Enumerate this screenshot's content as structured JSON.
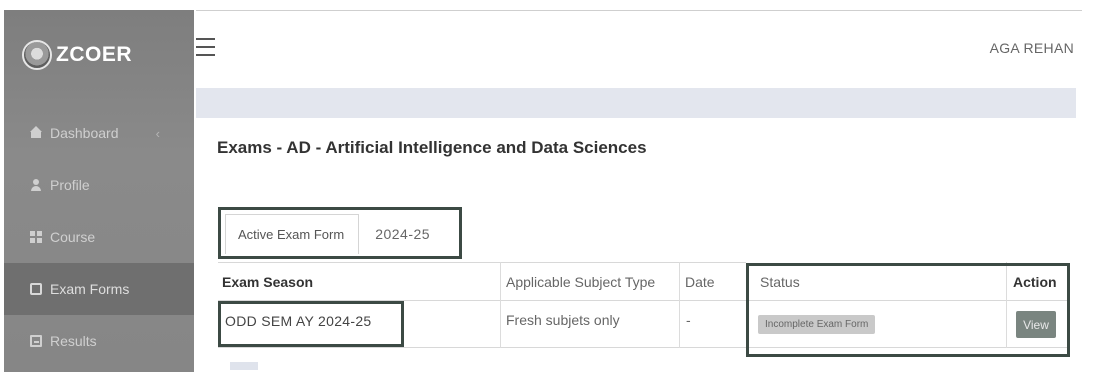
{
  "brand": {
    "name": "ZCOER",
    "logo_icon": "college-emblem-icon"
  },
  "sidebar": {
    "items": [
      {
        "label": "Dashboard",
        "icon": "home-icon",
        "active": false,
        "has_chevron": true
      },
      {
        "label": "Profile",
        "icon": "user-icon",
        "active": false
      },
      {
        "label": "Course",
        "icon": "grid-icon",
        "active": false
      },
      {
        "label": "Exam Forms",
        "icon": "document-icon",
        "active": true
      },
      {
        "label": "Results",
        "icon": "chart-icon",
        "active": false
      }
    ],
    "chevron": "‹"
  },
  "header": {
    "user_name": "AGA REHAN",
    "menu_icon": "hamburger-icon"
  },
  "main": {
    "title": "Exams - AD - Artificial Intelligence and Data Sciences",
    "tabs": {
      "active_label": "Active Exam Form",
      "year": "2024-25"
    },
    "table": {
      "headers": {
        "season": "Exam Season",
        "subject_type": "Applicable Subject Type",
        "date": "Date",
        "status": "Status",
        "action": "Action"
      },
      "rows": [
        {
          "season": "ODD SEM AY 2024-25",
          "subject_type": "Fresh subjets only",
          "date": "-",
          "status": "Incomplete Exam Form",
          "action": "View"
        }
      ]
    }
  },
  "colors": {
    "sidebar_bg": "#858585",
    "sidebar_active": "#6f6f6f",
    "highlight_border": "#3c4a44",
    "subbar_bg": "#e3e6ee",
    "view_button": "#7a8580"
  }
}
